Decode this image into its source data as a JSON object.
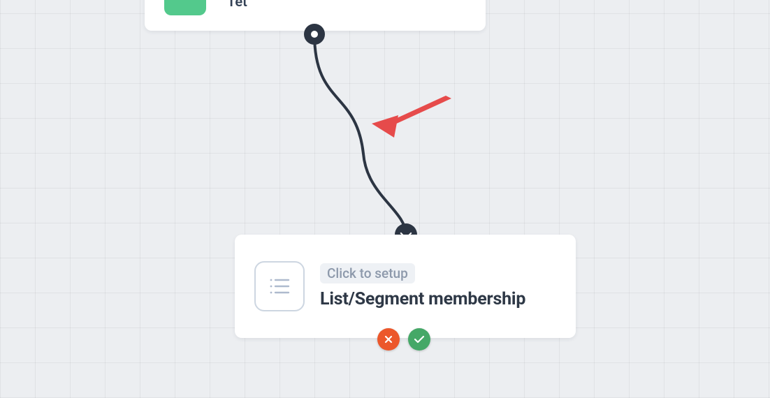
{
  "top_card": {
    "partial_text": "Tet"
  },
  "bottom_card": {
    "setup_label": "Click to setup",
    "title": "List/Segment membership",
    "icon_name": "list-icon"
  },
  "ports": {
    "in_symbol": "chevron-down",
    "fail_symbol": "x",
    "pass_symbol": "check"
  },
  "annotation": {
    "type": "arrow",
    "color": "#e64b4b"
  }
}
